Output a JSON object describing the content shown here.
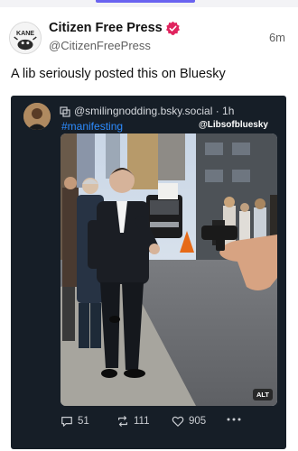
{
  "post": {
    "author_name": "Citizen Free Press",
    "author_handle": "@CitizenFreePress",
    "time": "6m",
    "text": "A lib seriously posted this on Bluesky",
    "avatar_text": "KANE"
  },
  "embed": {
    "handle": "@smilingnodding.bsky.social · 1h",
    "hashtag": "#manifesting",
    "watermark": "@Libsofbluesky",
    "alt_label": "ALT",
    "stats": {
      "replies": "51",
      "reposts": "111",
      "likes": "905"
    }
  },
  "icons": {
    "verified": "verified-badge-icon",
    "repost": "repost-icon",
    "reply": "reply-icon",
    "like": "heart-icon",
    "more": "more-dots-icon"
  },
  "colors": {
    "embed_background": "#161e27",
    "hashtag": "#2d8cff",
    "verified": "#e0245e",
    "accent": "#6a63f0"
  }
}
